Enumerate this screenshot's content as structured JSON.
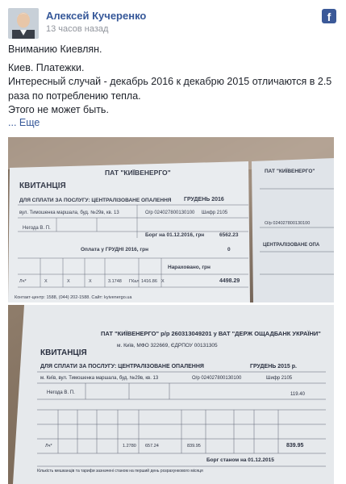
{
  "post": {
    "author": "Алексей Кучеренко",
    "time": "13 часов назад",
    "paragraphs": [
      "Вниманию Киевлян.",
      "Киев. Платежки.",
      "Интересный случай - декабрь 2016 к декабрю 2015 отличаются в 2.5 раза по потреблению тепла.",
      "Этого не может быть."
    ],
    "more_label": "... Еще",
    "brand_icon": "facebook-icon"
  },
  "receipt_top": {
    "company": "ПАТ \"КИЇВЕНЕРГО\"",
    "doc": "КВИТАНЦІЯ",
    "service": "ДЛЯ СПЛАТИ ЗА ПОСЛУГУ: ЦЕНТРАЛІЗОВАНЕ ОПАЛЕННЯ",
    "month": "ГРУДЕНЬ 2016",
    "address": "вул. Тимошенка маршала, буд. №29в, кв. 13",
    "account": "О/р 024027800130100",
    "code": "Шифр 2105",
    "person": "Негода В. П.",
    "debt": "Борг на 01.12.2016, грн",
    "debt_value": "6562.23",
    "pay_line": "Оплата у ГРУДНІ 2016, грн",
    "pay_value": "0",
    "accrued": "Нараховано, грн",
    "accrued_value": "4498.29",
    "row": [
      "Лч*",
      "X",
      "X",
      "X",
      "3.1748",
      "ГКал",
      "1416.86",
      "X"
    ],
    "contact": "Контакт-центр: 1588, (044) 202-1588. Сайт: kyivenergo.ua",
    "side_company": "ПАТ \"КИЇВЕНЕРГО\"",
    "side_service": "ЦЕНТРАЛІЗОВАНЕ ОПА",
    "side_account": "О/р 024027800130100"
  },
  "receipt_bottom": {
    "company": "ПАТ \"КИЇВЕНЕРГО\" р/р 260313049201 у ВАТ \"ДЕРЖ ОЩАДБАНК УКРАЇНИ\"",
    "bank": "м. Київ, МФО 322669, ЄДРПОУ 00131305",
    "doc": "КВИТАНЦІЯ",
    "service": "ДЛЯ СПЛАТИ ЗА ПОСЛУГУ: ЦЕНТРАЛІЗОВАНЕ ОПАЛЕННЯ",
    "month": "ГРУДЕНЬ 2015 р.",
    "address": "м. Київ, вул. Тимошенка маршала, буд. №29в, кв. 13",
    "account": "О/р 024027800130100",
    "code": "Шифр 2105",
    "person": "Негода В. П.",
    "area": "119.40",
    "row": [
      "Лч*",
      "1.2780",
      "657.24",
      "839.95",
      "839.95"
    ],
    "debt": "Борг станом на 01.12.2015",
    "footer": "Кількість мешканців та тарифи зазначені станом на перший день розрахункового місяця"
  }
}
